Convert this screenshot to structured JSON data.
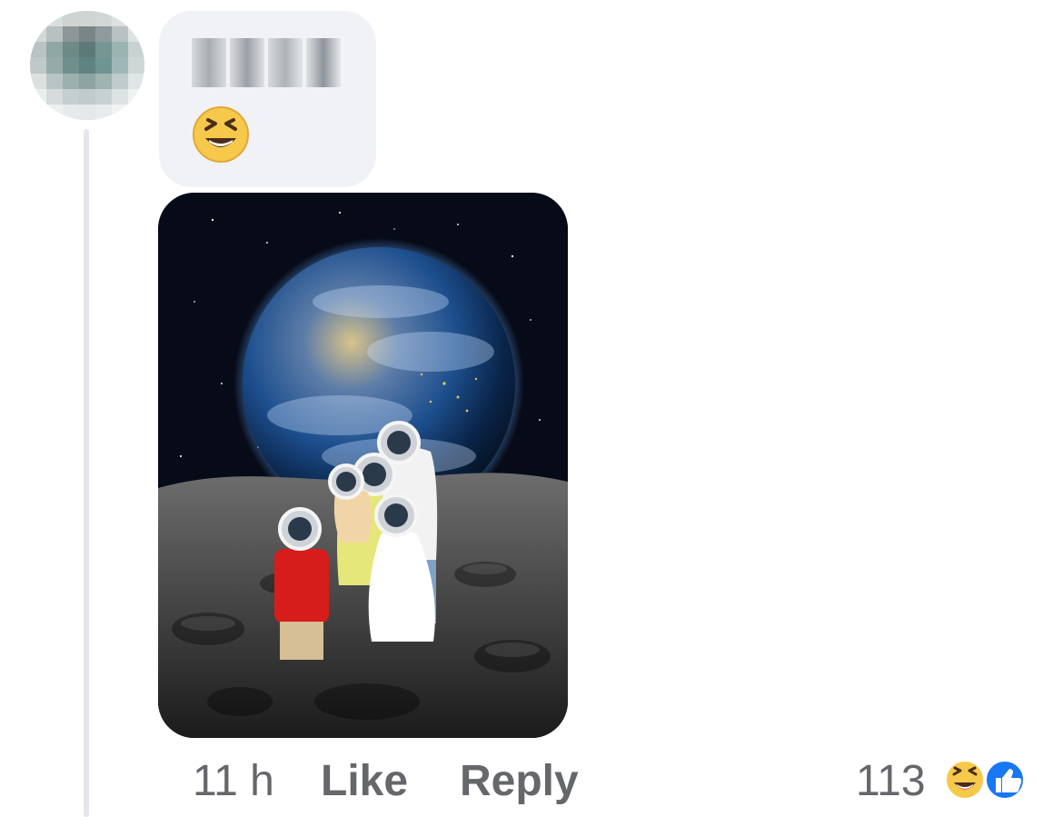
{
  "comment": {
    "emoji": "😆",
    "time": "11 h",
    "like_label": "Like",
    "reply_label": "Reply",
    "reaction_count": "113",
    "reactions": [
      "haha-icon",
      "like-icon"
    ]
  },
  "colors": {
    "bubble": "#f0f2f5",
    "muted_text": "#65676b",
    "thread_line": "#e4e6eb",
    "like_blue": "#1877f2",
    "emoji_yellow": "#f7c94b"
  }
}
